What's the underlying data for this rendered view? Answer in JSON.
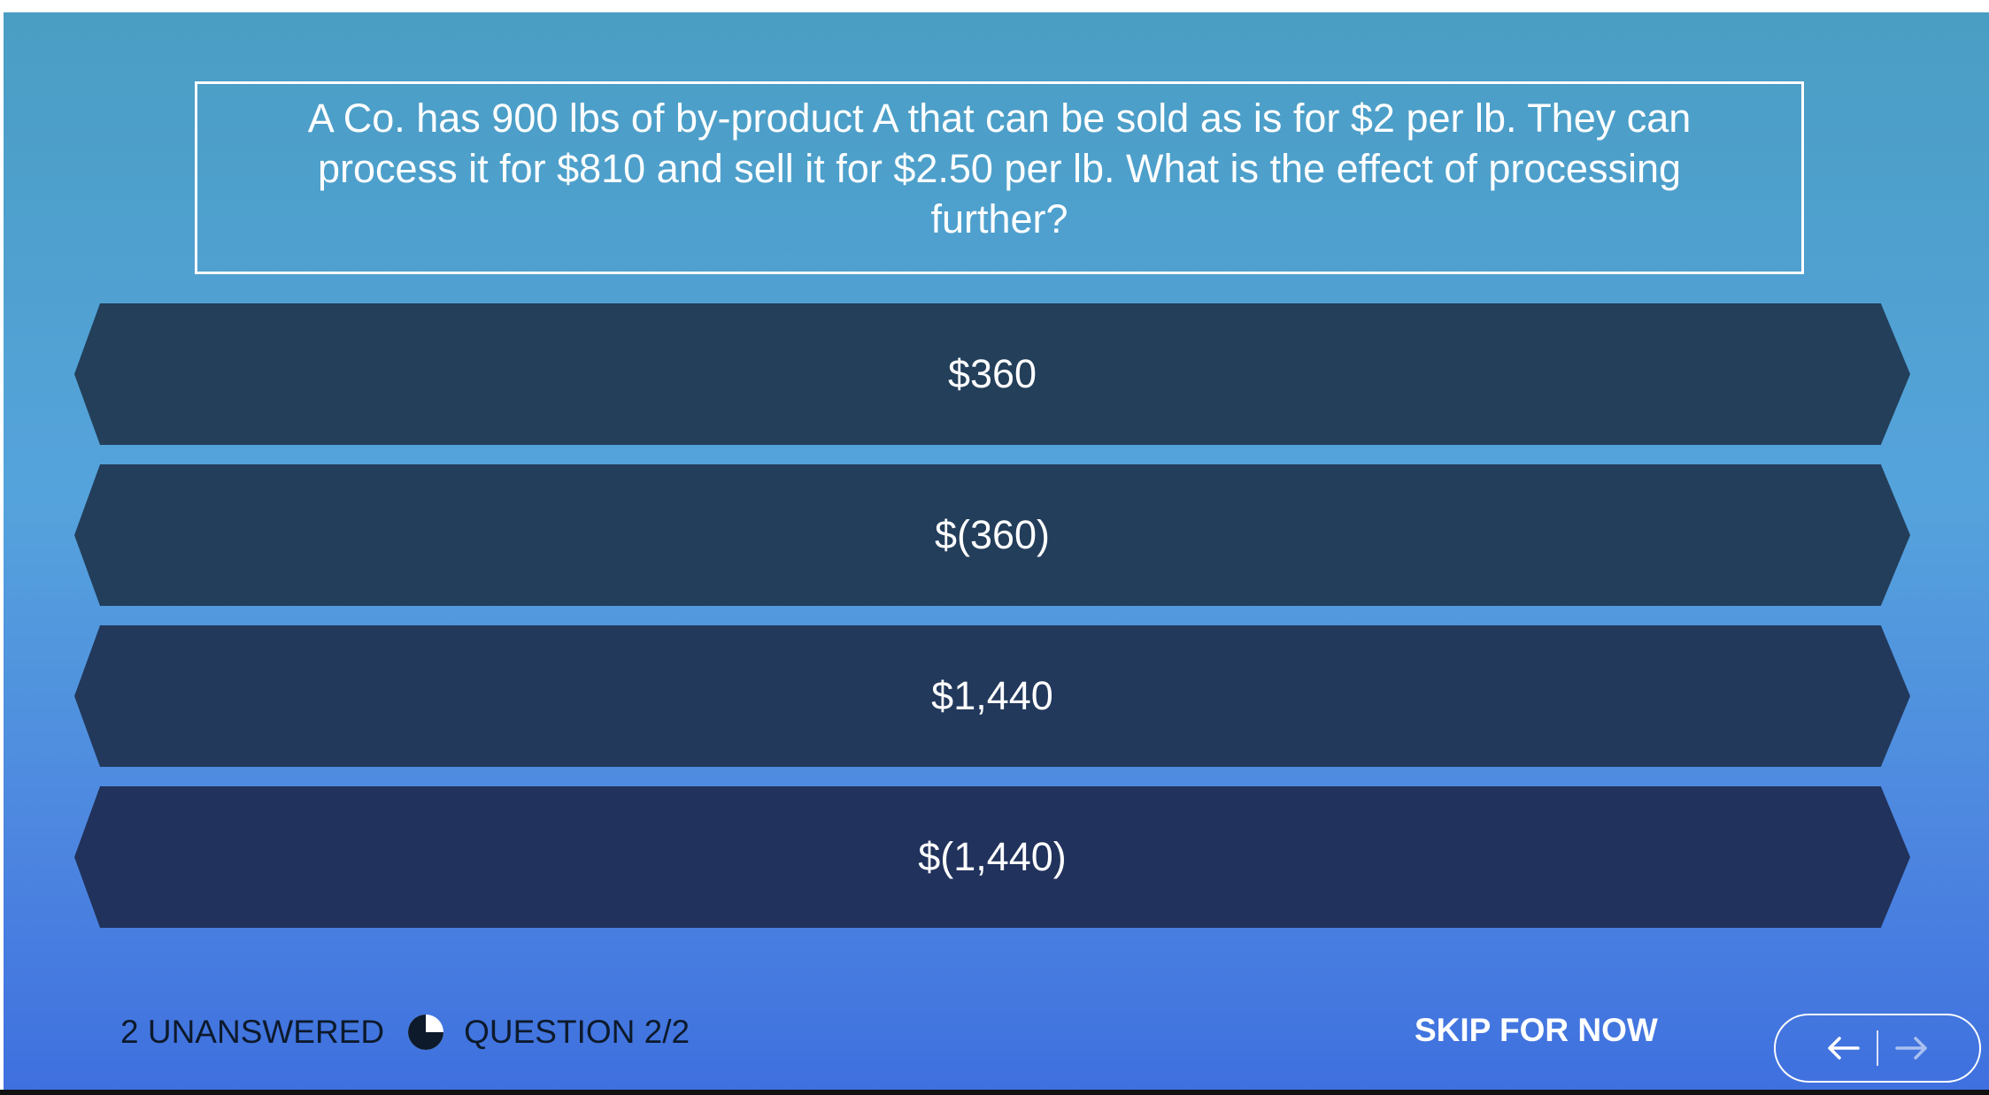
{
  "question": {
    "text": "A Co. has 900 lbs of by-product A that can be sold as is for $2 per lb. They can process it for $810 and sell it for $2.50 per lb. What is the effect of processing further?"
  },
  "answers": [
    {
      "label": "$360"
    },
    {
      "label": "$(360)"
    },
    {
      "label": "$1,440"
    },
    {
      "label": "$(1,440)"
    }
  ],
  "footer": {
    "unanswered": "2 UNANSWERED",
    "question_counter": "QUESTION 2/2",
    "skip_label": "SKIP FOR NOW",
    "prev_icon": "arrow-left-icon",
    "next_icon": "arrow-right-icon",
    "progress_icon": "pie-progress-icon"
  },
  "colors": {
    "answer_bg": "#223f5a",
    "text": "#ffffff",
    "footer_text": "#0d1a2c"
  }
}
